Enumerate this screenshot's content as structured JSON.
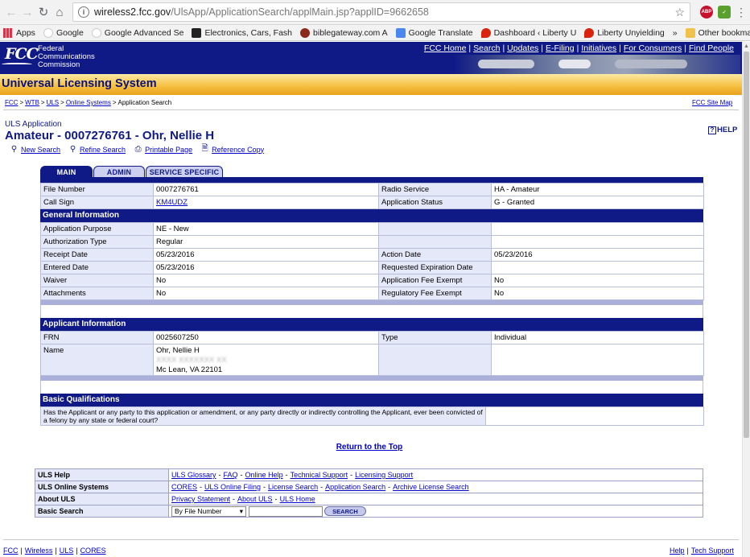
{
  "browser": {
    "url_host": "wireless2.fcc.gov",
    "url_path": "/UlsApp/ApplicationSearch/applMain.jsp?applID=9662658",
    "extensions": [
      "ABP",
      "✓"
    ],
    "bookmarks": [
      "Apps",
      "Google",
      "Google Advanced Se",
      "Electronics, Cars, Fash",
      "biblegateway.com A",
      "Google Translate",
      "Dashboard ‹ Liberty U",
      "Liberty Unyielding"
    ],
    "other_bookmarks": "Other bookmarks",
    "overflow": "»"
  },
  "fcc_header": {
    "logo": "FCC",
    "name_line1": "Federal",
    "name_line2": "Communications",
    "name_line3": "Commission",
    "top_links": [
      "FCC Home",
      "Search",
      "Updates",
      "E-Filing",
      "Initiatives",
      "For Consumers",
      "Find People"
    ]
  },
  "uls_title": "Universal Licensing System",
  "breadcrumb": [
    "FCC",
    "WTB",
    "ULS",
    "Online Systems"
  ],
  "breadcrumb_current": "Application Search",
  "breadcrumb_sep": ">",
  "site_map": "FCC Site Map",
  "app_label": "ULS Application",
  "app_title": "Amateur - 0007276761 - Ohr, Nellie H",
  "help_label": "HELP",
  "actions": {
    "new_search": "New Search",
    "refine_search": "Refine Search",
    "printable": "Printable Page",
    "reference": "Reference Copy"
  },
  "tabs": [
    "MAIN",
    "ADMIN",
    "SERVICE SPECIFIC"
  ],
  "summary": {
    "file_number_label": "File Number",
    "file_number": "0007276761",
    "radio_service_label": "Radio Service",
    "radio_service": "HA - Amateur",
    "call_sign_label": "Call Sign",
    "call_sign": "KM4UDZ",
    "status_label": "Application Status",
    "status": "G - Granted"
  },
  "general": {
    "header": "General Information",
    "purpose_label": "Application Purpose",
    "purpose": "NE - New",
    "auth_type_label": "Authorization Type",
    "auth_type": "Regular",
    "receipt_label": "Receipt Date",
    "receipt": "05/23/2016",
    "action_label": "Action Date",
    "action": "05/23/2016",
    "entered_label": "Entered Date",
    "entered": "05/23/2016",
    "req_exp_label": "Requested Expiration Date",
    "req_exp": "",
    "waiver_label": "Waiver",
    "waiver": "No",
    "app_fee_label": "Application Fee Exempt",
    "app_fee": "No",
    "attach_label": "Attachments",
    "attach": "No",
    "reg_fee_label": "Regulatory Fee Exempt",
    "reg_fee": "No"
  },
  "applicant": {
    "header": "Applicant Information",
    "frn_label": "FRN",
    "frn": "0025607250",
    "type_label": "Type",
    "type": "Individual",
    "name_label": "Name",
    "name_line1": "Ohr, Nellie H",
    "name_line2": "XXXX XXXXXXX XX",
    "name_line3": "Mc Lean, VA 22101"
  },
  "qualifications": {
    "header": "Basic Qualifications",
    "question": "Has the Applicant or any party to this application or amendment, or any party directly or indirectly controlling the Applicant, ever been convicted of a felony by any state or federal court?",
    "answer": ""
  },
  "return_top": "Return to the Top",
  "footer_nav": {
    "help_label": "ULS Help",
    "help_links": [
      "ULS Glossary",
      "FAQ",
      "Online Help",
      "Technical Support",
      "Licensing Support"
    ],
    "systems_label": "ULS Online Systems",
    "systems_links": [
      "CORES",
      "ULS Online Filing",
      "License Search",
      "Application Search",
      "Archive License Search"
    ],
    "about_label": "About ULS",
    "about_links": [
      "Privacy Statement",
      "About ULS",
      "ULS Home"
    ],
    "search_label": "Basic Search",
    "search_select": "By File Number",
    "search_input": "",
    "search_button": "SEARCH"
  },
  "link_sep": "-",
  "bar_sep": "|",
  "bottom_left": [
    "FCC",
    "Wireless",
    "ULS",
    "CORES"
  ],
  "bottom_right": [
    "Help",
    "Tech Support"
  ],
  "colors": {
    "fcc_blue": "#101a86",
    "label_bg": "#e5e8f8",
    "banner_gold": "#f6c244"
  }
}
